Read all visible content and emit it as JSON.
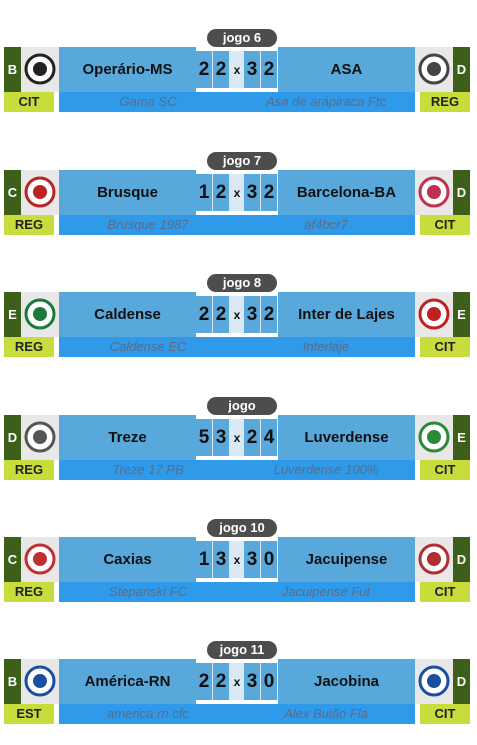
{
  "games": [
    {
      "label": "jogo 6",
      "home": {
        "division": "B",
        "team": "Operário-MS",
        "logo": "operario-ms-crest",
        "category": "CIT",
        "owner": "Gama SC"
      },
      "away": {
        "division": "D",
        "team": "ASA",
        "logo": "asa-crest",
        "category": "REG",
        "owner": "Asa de arápiraca Ftc"
      },
      "score": {
        "home": [
          "2",
          "2"
        ],
        "away": [
          "3",
          "2"
        ]
      },
      "sep": "x"
    },
    {
      "label": "jogo 7",
      "home": {
        "division": "C",
        "team": "Brusque",
        "logo": "brusque-crest",
        "category": "REG",
        "owner": "Brusque 1987"
      },
      "away": {
        "division": "D",
        "team": "Barcelona-BA",
        "logo": "barcelona-ba-crest",
        "category": "CIT",
        "owner": "af4bcr7"
      },
      "score": {
        "home": [
          "1",
          "2"
        ],
        "away": [
          "3",
          "2"
        ]
      },
      "sep": "x"
    },
    {
      "label": "jogo 8",
      "home": {
        "division": "E",
        "team": "Caldense",
        "logo": "caldense-crest",
        "category": "REG",
        "owner": "Caldense EC"
      },
      "away": {
        "division": "E",
        "team": "Inter de Lajes",
        "logo": "inter-de-lajes-crest",
        "category": "CIT",
        "owner": "Interlaje"
      },
      "score": {
        "home": [
          "2",
          "2"
        ],
        "away": [
          "3",
          "2"
        ]
      },
      "sep": "x"
    },
    {
      "label": "jogo",
      "home": {
        "division": "D",
        "team": "Treze",
        "logo": "treze-crest",
        "category": "REG",
        "owner": "Treze 17 PB"
      },
      "away": {
        "division": "E",
        "team": "Luverdense",
        "logo": "luverdense-crest",
        "category": "CIT",
        "owner": "Luverdense 100%"
      },
      "score": {
        "home": [
          "5",
          "3"
        ],
        "away": [
          "2",
          "4"
        ]
      },
      "sep": "x"
    },
    {
      "label": "jogo 10",
      "home": {
        "division": "C",
        "team": "Caxias",
        "logo": "caxias-crest",
        "category": "REG",
        "owner": "Stepanski FC"
      },
      "away": {
        "division": "D",
        "team": "Jacuipense",
        "logo": "jacuipense-crest",
        "category": "CIT",
        "owner": "Jacuipense Fut"
      },
      "score": {
        "home": [
          "1",
          "3"
        ],
        "away": [
          "3",
          "0"
        ]
      },
      "sep": "x"
    },
    {
      "label": "jogo 11",
      "home": {
        "division": "B",
        "team": "América-RN",
        "logo": "america-rn-crest",
        "category": "EST",
        "owner": "america rn cfc"
      },
      "away": {
        "division": "D",
        "team": "Jacobina",
        "logo": "jacobina-crest",
        "category": "CIT",
        "owner": "Alex Buião Fla"
      },
      "score": {
        "home": [
          "2",
          "2"
        ],
        "away": [
          "3",
          "0"
        ]
      },
      "sep": "x"
    }
  ],
  "colors": {
    "division_bg": "#3e5f1a",
    "team_bg": "#58a8dc",
    "owner_bg": "#2f9aea",
    "category_bg": "#c8dc3c",
    "label_bg": "#4d4d4d"
  }
}
